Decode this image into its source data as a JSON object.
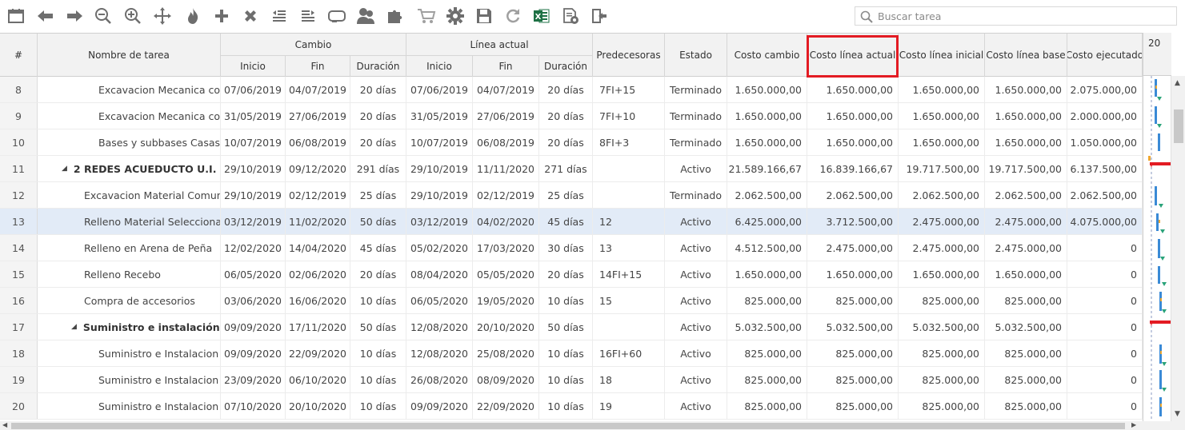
{
  "toolbar": {
    "icons": [
      "calendar-icon",
      "arrow-left-icon",
      "arrow-right-icon",
      "zoom-out-icon",
      "zoom-in-icon",
      "move-icon",
      "fire-icon",
      "add-icon",
      "delete-icon",
      "outdent-icon",
      "indent-icon",
      "link-icon",
      "resources-icon",
      "puzzle-icon",
      "cart-icon",
      "settings-icon",
      "save-icon",
      "refresh-icon",
      "excel-icon",
      "document-settings-icon",
      "exit-icon"
    ],
    "search_placeholder": "Buscar tarea"
  },
  "colors": {
    "highlight": "#e31b23",
    "selected_row": "#e2ebf7",
    "header_bg": "#f2f2f2"
  },
  "header": {
    "num": "#",
    "name": "Nombre de tarea",
    "cambio": "Cambio",
    "linea_actual": "Línea actual",
    "inicio": "Inicio",
    "fin": "Fin",
    "duracion": "Duración",
    "inicio2": "Inicio",
    "fin2": "Fin",
    "duracion2": "Duración",
    "predecesoras": "Predecesoras",
    "estado": "Estado",
    "costo_cambio": "Costo cambio",
    "costo_linea_actual": "Costo línea actual",
    "costo_linea_inicial": "Costo línea inicial",
    "costo_linea_base": "Costo línea base",
    "costo_ejecutado": "Costo ejecutado",
    "gantt_year": "20"
  },
  "rows": [
    {
      "num": "8",
      "name": "Excavacion Mecanica con",
      "level": 2,
      "group": false,
      "c_inicio": "07/06/2019",
      "c_fin": "04/07/2019",
      "c_dur": "20 días",
      "l_inicio": "07/06/2019",
      "l_fin": "04/07/2019",
      "l_dur": "20 días",
      "pred": "7FI+15",
      "estado": "Terminado",
      "costo_cambio": "1.650.000,00",
      "costo_actual": "1.650.000,00",
      "costo_inicial": "1.650.000,00",
      "costo_base": "1.650.000,00",
      "costo_ejecutado": "2.075.000,00"
    },
    {
      "num": "9",
      "name": "Excavacion Mecanica con",
      "level": 2,
      "group": false,
      "c_inicio": "31/05/2019",
      "c_fin": "27/06/2019",
      "c_dur": "20 días",
      "l_inicio": "31/05/2019",
      "l_fin": "27/06/2019",
      "l_dur": "20 días",
      "pred": "7FI+10",
      "estado": "Terminado",
      "costo_cambio": "1.650.000,00",
      "costo_actual": "1.650.000,00",
      "costo_inicial": "1.650.000,00",
      "costo_base": "1.650.000,00",
      "costo_ejecutado": "2.000.000,00"
    },
    {
      "num": "10",
      "name": "Bases y subbases Casas,",
      "level": 2,
      "group": false,
      "c_inicio": "10/07/2019",
      "c_fin": "06/08/2019",
      "c_dur": "20 días",
      "l_inicio": "10/07/2019",
      "l_fin": "06/08/2019",
      "l_dur": "20 días",
      "pred": "8FI+3",
      "estado": "Terminado",
      "costo_cambio": "1.650.000,00",
      "costo_actual": "1.650.000,00",
      "costo_inicial": "1.650.000,00",
      "costo_base": "1.650.000,00",
      "costo_ejecutado": "1.050.000,00"
    },
    {
      "num": "11",
      "name": "2 REDES ACUEDUCTO U.I.",
      "level": 0,
      "group": true,
      "c_inicio": "29/10/2019",
      "c_fin": "09/12/2020",
      "c_dur": "291 días",
      "l_inicio": "29/10/2019",
      "l_fin": "11/11/2020",
      "l_dur": "271 días",
      "pred": "",
      "estado": "Activo",
      "costo_cambio": "21.589.166,67",
      "costo_actual": "16.839.166,67",
      "costo_inicial": "19.717.500,00",
      "costo_base": "19.717.500,00",
      "costo_ejecutado": "6.137.500,00"
    },
    {
      "num": "12",
      "name": "Excavacion Material Comun",
      "level": 1,
      "group": false,
      "c_inicio": "29/10/2019",
      "c_fin": "02/12/2019",
      "c_dur": "25 días",
      "l_inicio": "29/10/2019",
      "l_fin": "02/12/2019",
      "l_dur": "25 días",
      "pred": "",
      "estado": "Terminado",
      "costo_cambio": "2.062.500,00",
      "costo_actual": "2.062.500,00",
      "costo_inicial": "2.062.500,00",
      "costo_base": "2.062.500,00",
      "costo_ejecutado": "2.062.500,00"
    },
    {
      "num": "13",
      "name": "Relleno Material Seleccionad",
      "level": 1,
      "group": false,
      "selected": true,
      "c_inicio": "03/12/2019",
      "c_fin": "11/02/2020",
      "c_dur": "50 días",
      "l_inicio": "03/12/2019",
      "l_fin": "04/02/2020",
      "l_dur": "45 días",
      "pred": "12",
      "estado": "Activo",
      "costo_cambio": "6.425.000,00",
      "costo_actual": "3.712.500,00",
      "costo_inicial": "2.475.000,00",
      "costo_base": "2.475.000,00",
      "costo_ejecutado": "4.075.000,00"
    },
    {
      "num": "14",
      "name": "Relleno en Arena de Peña",
      "level": 1,
      "group": false,
      "c_inicio": "12/02/2020",
      "c_fin": "14/04/2020",
      "c_dur": "45 días",
      "l_inicio": "05/02/2020",
      "l_fin": "17/03/2020",
      "l_dur": "30 días",
      "pred": "13",
      "estado": "Activo",
      "costo_cambio": "4.512.500,00",
      "costo_actual": "2.475.000,00",
      "costo_inicial": "2.475.000,00",
      "costo_base": "2.475.000,00",
      "costo_ejecutado": "0"
    },
    {
      "num": "15",
      "name": "Relleno Recebo",
      "level": 1,
      "group": false,
      "c_inicio": "06/05/2020",
      "c_fin": "02/06/2020",
      "c_dur": "20 días",
      "l_inicio": "08/04/2020",
      "l_fin": "05/05/2020",
      "l_dur": "20 días",
      "pred": "14FI+15",
      "estado": "Activo",
      "costo_cambio": "1.650.000,00",
      "costo_actual": "1.650.000,00",
      "costo_inicial": "1.650.000,00",
      "costo_base": "1.650.000,00",
      "costo_ejecutado": "0"
    },
    {
      "num": "16",
      "name": "Compra de accesorios",
      "level": 1,
      "group": false,
      "c_inicio": "03/06/2020",
      "c_fin": "16/06/2020",
      "c_dur": "10 días",
      "l_inicio": "06/05/2020",
      "l_fin": "19/05/2020",
      "l_dur": "10 días",
      "pred": "15",
      "estado": "Activo",
      "costo_cambio": "825.000,00",
      "costo_actual": "825.000,00",
      "costo_inicial": "825.000,00",
      "costo_base": "825.000,00",
      "costo_ejecutado": "0"
    },
    {
      "num": "17",
      "name": "Suministro e instalación",
      "level": 1,
      "group": true,
      "c_inicio": "09/09/2020",
      "c_fin": "17/11/2020",
      "c_dur": "50 días",
      "l_inicio": "12/08/2020",
      "l_fin": "20/10/2020",
      "l_dur": "50 días",
      "pred": "",
      "estado": "Activo",
      "costo_cambio": "5.032.500,00",
      "costo_actual": "5.032.500,00",
      "costo_inicial": "5.032.500,00",
      "costo_base": "5.032.500,00",
      "costo_ejecutado": "0"
    },
    {
      "num": "18",
      "name": "Suministro e Instalacion",
      "level": 2,
      "group": false,
      "c_inicio": "09/09/2020",
      "c_fin": "22/09/2020",
      "c_dur": "10 días",
      "l_inicio": "12/08/2020",
      "l_fin": "25/08/2020",
      "l_dur": "10 días",
      "pred": "16FI+60",
      "estado": "Activo",
      "costo_cambio": "825.000,00",
      "costo_actual": "825.000,00",
      "costo_inicial": "825.000,00",
      "costo_base": "825.000,00",
      "costo_ejecutado": "0"
    },
    {
      "num": "19",
      "name": "Suministro e Instalacion",
      "level": 2,
      "group": false,
      "c_inicio": "23/09/2020",
      "c_fin": "06/10/2020",
      "c_dur": "10 días",
      "l_inicio": "26/08/2020",
      "l_fin": "08/09/2020",
      "l_dur": "10 días",
      "pred": "18",
      "estado": "Activo",
      "costo_cambio": "825.000,00",
      "costo_actual": "825.000,00",
      "costo_inicial": "825.000,00",
      "costo_base": "825.000,00",
      "costo_ejecutado": "0"
    },
    {
      "num": "20",
      "name": "Suministro e Instalacion",
      "level": 2,
      "group": false,
      "c_inicio": "07/10/2020",
      "c_fin": "20/10/2020",
      "c_dur": "10 días",
      "l_inicio": "09/09/2020",
      "l_fin": "22/09/2020",
      "l_dur": "10 días",
      "pred": "19",
      "estado": "Activo",
      "costo_cambio": "825.000,00",
      "costo_actual": "825.000,00",
      "costo_inicial": "825.000,00",
      "costo_base": "825.000,00",
      "costo_ejecutado": "0"
    }
  ]
}
